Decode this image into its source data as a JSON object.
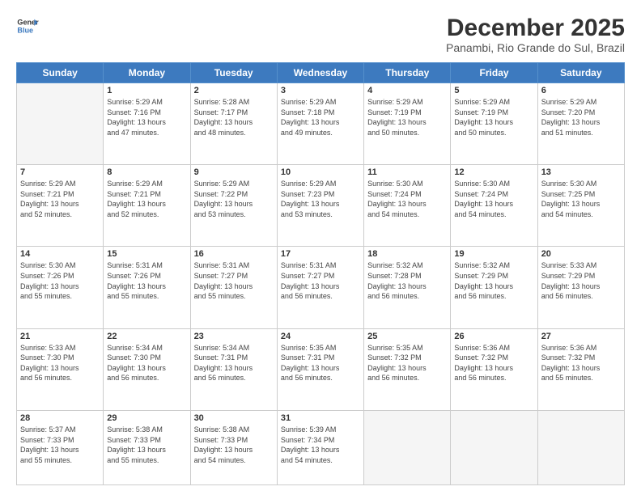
{
  "header": {
    "logo_line1": "General",
    "logo_line2": "Blue",
    "title": "December 2025",
    "subtitle": "Panambi, Rio Grande do Sul, Brazil"
  },
  "weekdays": [
    "Sunday",
    "Monday",
    "Tuesday",
    "Wednesday",
    "Thursday",
    "Friday",
    "Saturday"
  ],
  "weeks": [
    [
      {
        "day": "",
        "info": ""
      },
      {
        "day": "1",
        "info": "Sunrise: 5:29 AM\nSunset: 7:16 PM\nDaylight: 13 hours\nand 47 minutes."
      },
      {
        "day": "2",
        "info": "Sunrise: 5:28 AM\nSunset: 7:17 PM\nDaylight: 13 hours\nand 48 minutes."
      },
      {
        "day": "3",
        "info": "Sunrise: 5:29 AM\nSunset: 7:18 PM\nDaylight: 13 hours\nand 49 minutes."
      },
      {
        "day": "4",
        "info": "Sunrise: 5:29 AM\nSunset: 7:19 PM\nDaylight: 13 hours\nand 50 minutes."
      },
      {
        "day": "5",
        "info": "Sunrise: 5:29 AM\nSunset: 7:19 PM\nDaylight: 13 hours\nand 50 minutes."
      },
      {
        "day": "6",
        "info": "Sunrise: 5:29 AM\nSunset: 7:20 PM\nDaylight: 13 hours\nand 51 minutes."
      }
    ],
    [
      {
        "day": "7",
        "info": "Sunrise: 5:29 AM\nSunset: 7:21 PM\nDaylight: 13 hours\nand 52 minutes."
      },
      {
        "day": "8",
        "info": "Sunrise: 5:29 AM\nSunset: 7:21 PM\nDaylight: 13 hours\nand 52 minutes."
      },
      {
        "day": "9",
        "info": "Sunrise: 5:29 AM\nSunset: 7:22 PM\nDaylight: 13 hours\nand 53 minutes."
      },
      {
        "day": "10",
        "info": "Sunrise: 5:29 AM\nSunset: 7:23 PM\nDaylight: 13 hours\nand 53 minutes."
      },
      {
        "day": "11",
        "info": "Sunrise: 5:30 AM\nSunset: 7:24 PM\nDaylight: 13 hours\nand 54 minutes."
      },
      {
        "day": "12",
        "info": "Sunrise: 5:30 AM\nSunset: 7:24 PM\nDaylight: 13 hours\nand 54 minutes."
      },
      {
        "day": "13",
        "info": "Sunrise: 5:30 AM\nSunset: 7:25 PM\nDaylight: 13 hours\nand 54 minutes."
      }
    ],
    [
      {
        "day": "14",
        "info": "Sunrise: 5:30 AM\nSunset: 7:26 PM\nDaylight: 13 hours\nand 55 minutes."
      },
      {
        "day": "15",
        "info": "Sunrise: 5:31 AM\nSunset: 7:26 PM\nDaylight: 13 hours\nand 55 minutes."
      },
      {
        "day": "16",
        "info": "Sunrise: 5:31 AM\nSunset: 7:27 PM\nDaylight: 13 hours\nand 55 minutes."
      },
      {
        "day": "17",
        "info": "Sunrise: 5:31 AM\nSunset: 7:27 PM\nDaylight: 13 hours\nand 56 minutes."
      },
      {
        "day": "18",
        "info": "Sunrise: 5:32 AM\nSunset: 7:28 PM\nDaylight: 13 hours\nand 56 minutes."
      },
      {
        "day": "19",
        "info": "Sunrise: 5:32 AM\nSunset: 7:29 PM\nDaylight: 13 hours\nand 56 minutes."
      },
      {
        "day": "20",
        "info": "Sunrise: 5:33 AM\nSunset: 7:29 PM\nDaylight: 13 hours\nand 56 minutes."
      }
    ],
    [
      {
        "day": "21",
        "info": "Sunrise: 5:33 AM\nSunset: 7:30 PM\nDaylight: 13 hours\nand 56 minutes."
      },
      {
        "day": "22",
        "info": "Sunrise: 5:34 AM\nSunset: 7:30 PM\nDaylight: 13 hours\nand 56 minutes."
      },
      {
        "day": "23",
        "info": "Sunrise: 5:34 AM\nSunset: 7:31 PM\nDaylight: 13 hours\nand 56 minutes."
      },
      {
        "day": "24",
        "info": "Sunrise: 5:35 AM\nSunset: 7:31 PM\nDaylight: 13 hours\nand 56 minutes."
      },
      {
        "day": "25",
        "info": "Sunrise: 5:35 AM\nSunset: 7:32 PM\nDaylight: 13 hours\nand 56 minutes."
      },
      {
        "day": "26",
        "info": "Sunrise: 5:36 AM\nSunset: 7:32 PM\nDaylight: 13 hours\nand 56 minutes."
      },
      {
        "day": "27",
        "info": "Sunrise: 5:36 AM\nSunset: 7:32 PM\nDaylight: 13 hours\nand 55 minutes."
      }
    ],
    [
      {
        "day": "28",
        "info": "Sunrise: 5:37 AM\nSunset: 7:33 PM\nDaylight: 13 hours\nand 55 minutes."
      },
      {
        "day": "29",
        "info": "Sunrise: 5:38 AM\nSunset: 7:33 PM\nDaylight: 13 hours\nand 55 minutes."
      },
      {
        "day": "30",
        "info": "Sunrise: 5:38 AM\nSunset: 7:33 PM\nDaylight: 13 hours\nand 54 minutes."
      },
      {
        "day": "31",
        "info": "Sunrise: 5:39 AM\nSunset: 7:34 PM\nDaylight: 13 hours\nand 54 minutes."
      },
      {
        "day": "",
        "info": ""
      },
      {
        "day": "",
        "info": ""
      },
      {
        "day": "",
        "info": ""
      }
    ]
  ]
}
